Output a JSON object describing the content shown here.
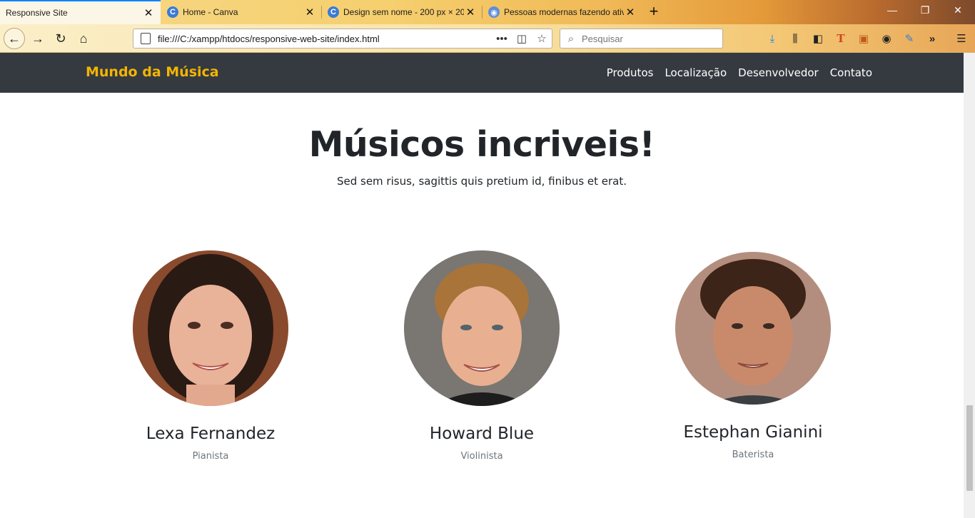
{
  "browser": {
    "tabs": [
      {
        "title": "Responsive Site",
        "active": true
      },
      {
        "title": "Home - Canva",
        "active": false
      },
      {
        "title": "Design sem nome - 200 px × 20",
        "active": false
      },
      {
        "title": "Pessoas modernas fazendo ativ",
        "active": false
      }
    ],
    "url": "file:///C:/xampp/htdocs/responsive-web-site/index.html",
    "search_placeholder": "Pesquisar"
  },
  "site": {
    "brand": "Mundo da Música",
    "nav": [
      "Produtos",
      "Localização",
      "Desenvolvedor",
      "Contato"
    ],
    "heading": "Músicos incriveis!",
    "subheading": "Sed sem risus, sagittis quis pretium id, finibus et erat.",
    "musicians": [
      {
        "name": "Lexa Fernandez",
        "role": "Pianista"
      },
      {
        "name": "Howard Blue",
        "role": "Violinista"
      },
      {
        "name": "Estephan Gianini",
        "role": "Baterista"
      }
    ]
  },
  "colors": {
    "navbar_bg": "#343a40",
    "brand": "#f5b400",
    "heading": "#212529",
    "muted": "#6c757d"
  }
}
